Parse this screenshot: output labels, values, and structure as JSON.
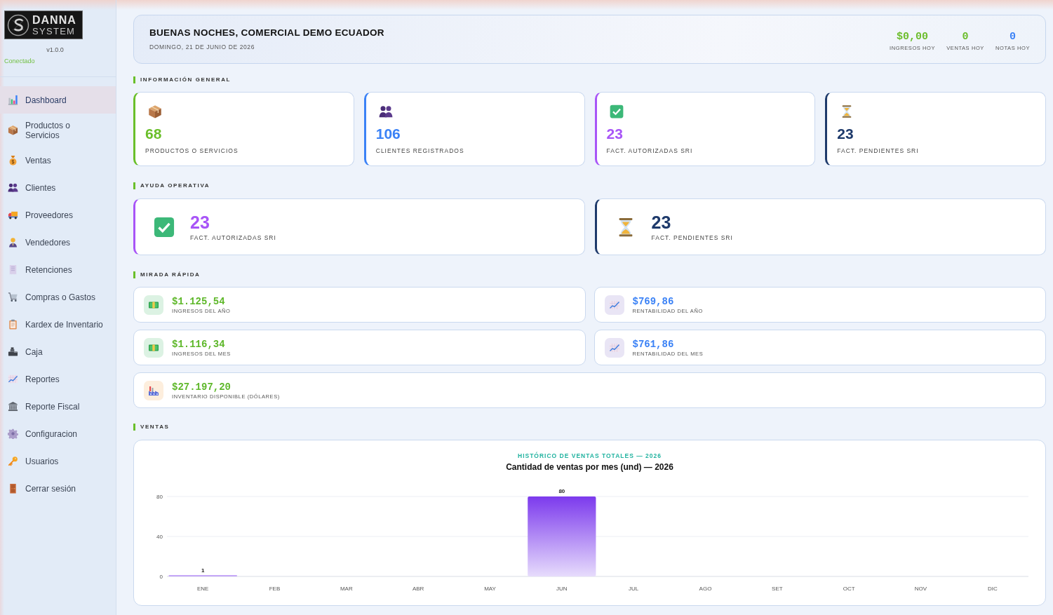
{
  "sidebar": {
    "logo": {
      "line_1": "DANNA",
      "line_2": "SYSTEM"
    },
    "version": "v1.0.0",
    "status": "Conectado",
    "items": [
      {
        "label": "Dashboard",
        "selected": true
      },
      {
        "label": "Productos o Servicios",
        "selected": false
      },
      {
        "label": "Ventas",
        "selected": false
      },
      {
        "label": "Clientes",
        "selected": false
      },
      {
        "label": "Proveedores",
        "selected": false
      },
      {
        "label": "Vendedores",
        "selected": false
      },
      {
        "label": "Retenciones",
        "selected": false
      },
      {
        "label": "Compras o Gastos",
        "selected": false
      },
      {
        "label": "Kardex de Inventario",
        "selected": false
      },
      {
        "label": "Caja",
        "selected": false
      },
      {
        "label": "Reportes",
        "selected": false
      },
      {
        "label": "Reporte Fiscal",
        "selected": false
      },
      {
        "label": "Configuracion",
        "selected": false
      },
      {
        "label": "Usuarios",
        "selected": false
      },
      {
        "label": "Cerrar sesión",
        "selected": false
      }
    ]
  },
  "header": {
    "greeting": "BUENAS NOCHES, COMERCIAL DEMO ECUADOR",
    "date": "DOMINGO, 21 DE JUNIO DE 2026",
    "stats": [
      {
        "value": "$0,00",
        "label": "INGRESOS HOY",
        "color": "#6cbd2c"
      },
      {
        "value": "0",
        "label": "VENTAS HOY",
        "color": "#6cbd2c"
      },
      {
        "value": "0",
        "label": "NOTAS HOY",
        "color": "#3b82f6"
      }
    ]
  },
  "informacion_general": {
    "title": "INFORMACIÓN GENERAL",
    "cards": [
      {
        "value": "68",
        "label": "PRODUCTOS O SERVICIOS",
        "color": "#6abf2a"
      },
      {
        "value": "106",
        "label": "CLIENTES REGISTRADOS",
        "color": "#3b82f6"
      },
      {
        "value": "23",
        "label": "FACT. AUTORIZADAS SRI",
        "color": "#a855f7"
      },
      {
        "value": "23",
        "label": "FACT. PENDIENTES SRI",
        "color": "#1e3a6b"
      }
    ]
  },
  "ayuda_operativa": {
    "title": "AYUDA OPERATIVA",
    "cards": [
      {
        "value": "23",
        "label": "FACT. AUTORIZADAS SRI",
        "color": "#a855f7"
      },
      {
        "value": "23",
        "label": "FACT. PENDIENTES SRI",
        "color": "#1e3a6b"
      }
    ]
  },
  "mirada_rapida": {
    "title": "MIRADA RÁPIDA",
    "cards": [
      {
        "value": "$1.125,54",
        "label": "INGRESOS DEL AÑO",
        "color": "#5fb82b"
      },
      {
        "value": "$769,86",
        "label": "RENTABILIDAD DEL AÑO",
        "color": "#3b82f6"
      },
      {
        "value": "$1.116,34",
        "label": "INGRESOS DEL MES",
        "color": "#5fb82b"
      },
      {
        "value": "$761,86",
        "label": "RENTABILIDAD DEL MES",
        "color": "#3b82f6"
      },
      {
        "value": "$27.197,20",
        "label": "INVENTARIO DISPONIBLE (DÓLARES)",
        "color": "#5fb82b"
      }
    ]
  },
  "ventas": {
    "title": "VENTAS",
    "heading": "HISTÓRICO DE VENTAS TOTALES — 2026",
    "chart_data": {
      "type": "bar",
      "title": "Cantidad de ventas por mes (und) — 2026",
      "categories": [
        "ENE",
        "FEB",
        "MAR",
        "ABR",
        "MAY",
        "JUN",
        "JUL",
        "AGO",
        "SET",
        "OCT",
        "NOV",
        "DIC"
      ],
      "values": [
        1,
        0,
        0,
        0,
        0,
        80,
        0,
        0,
        0,
        0,
        0,
        0
      ],
      "ylim": [
        0,
        80
      ],
      "yticks": [
        0,
        40,
        80
      ],
      "value_labels": [
        "1",
        null,
        null,
        null,
        null,
        "80",
        null,
        null,
        null,
        null,
        null,
        null
      ]
    }
  }
}
